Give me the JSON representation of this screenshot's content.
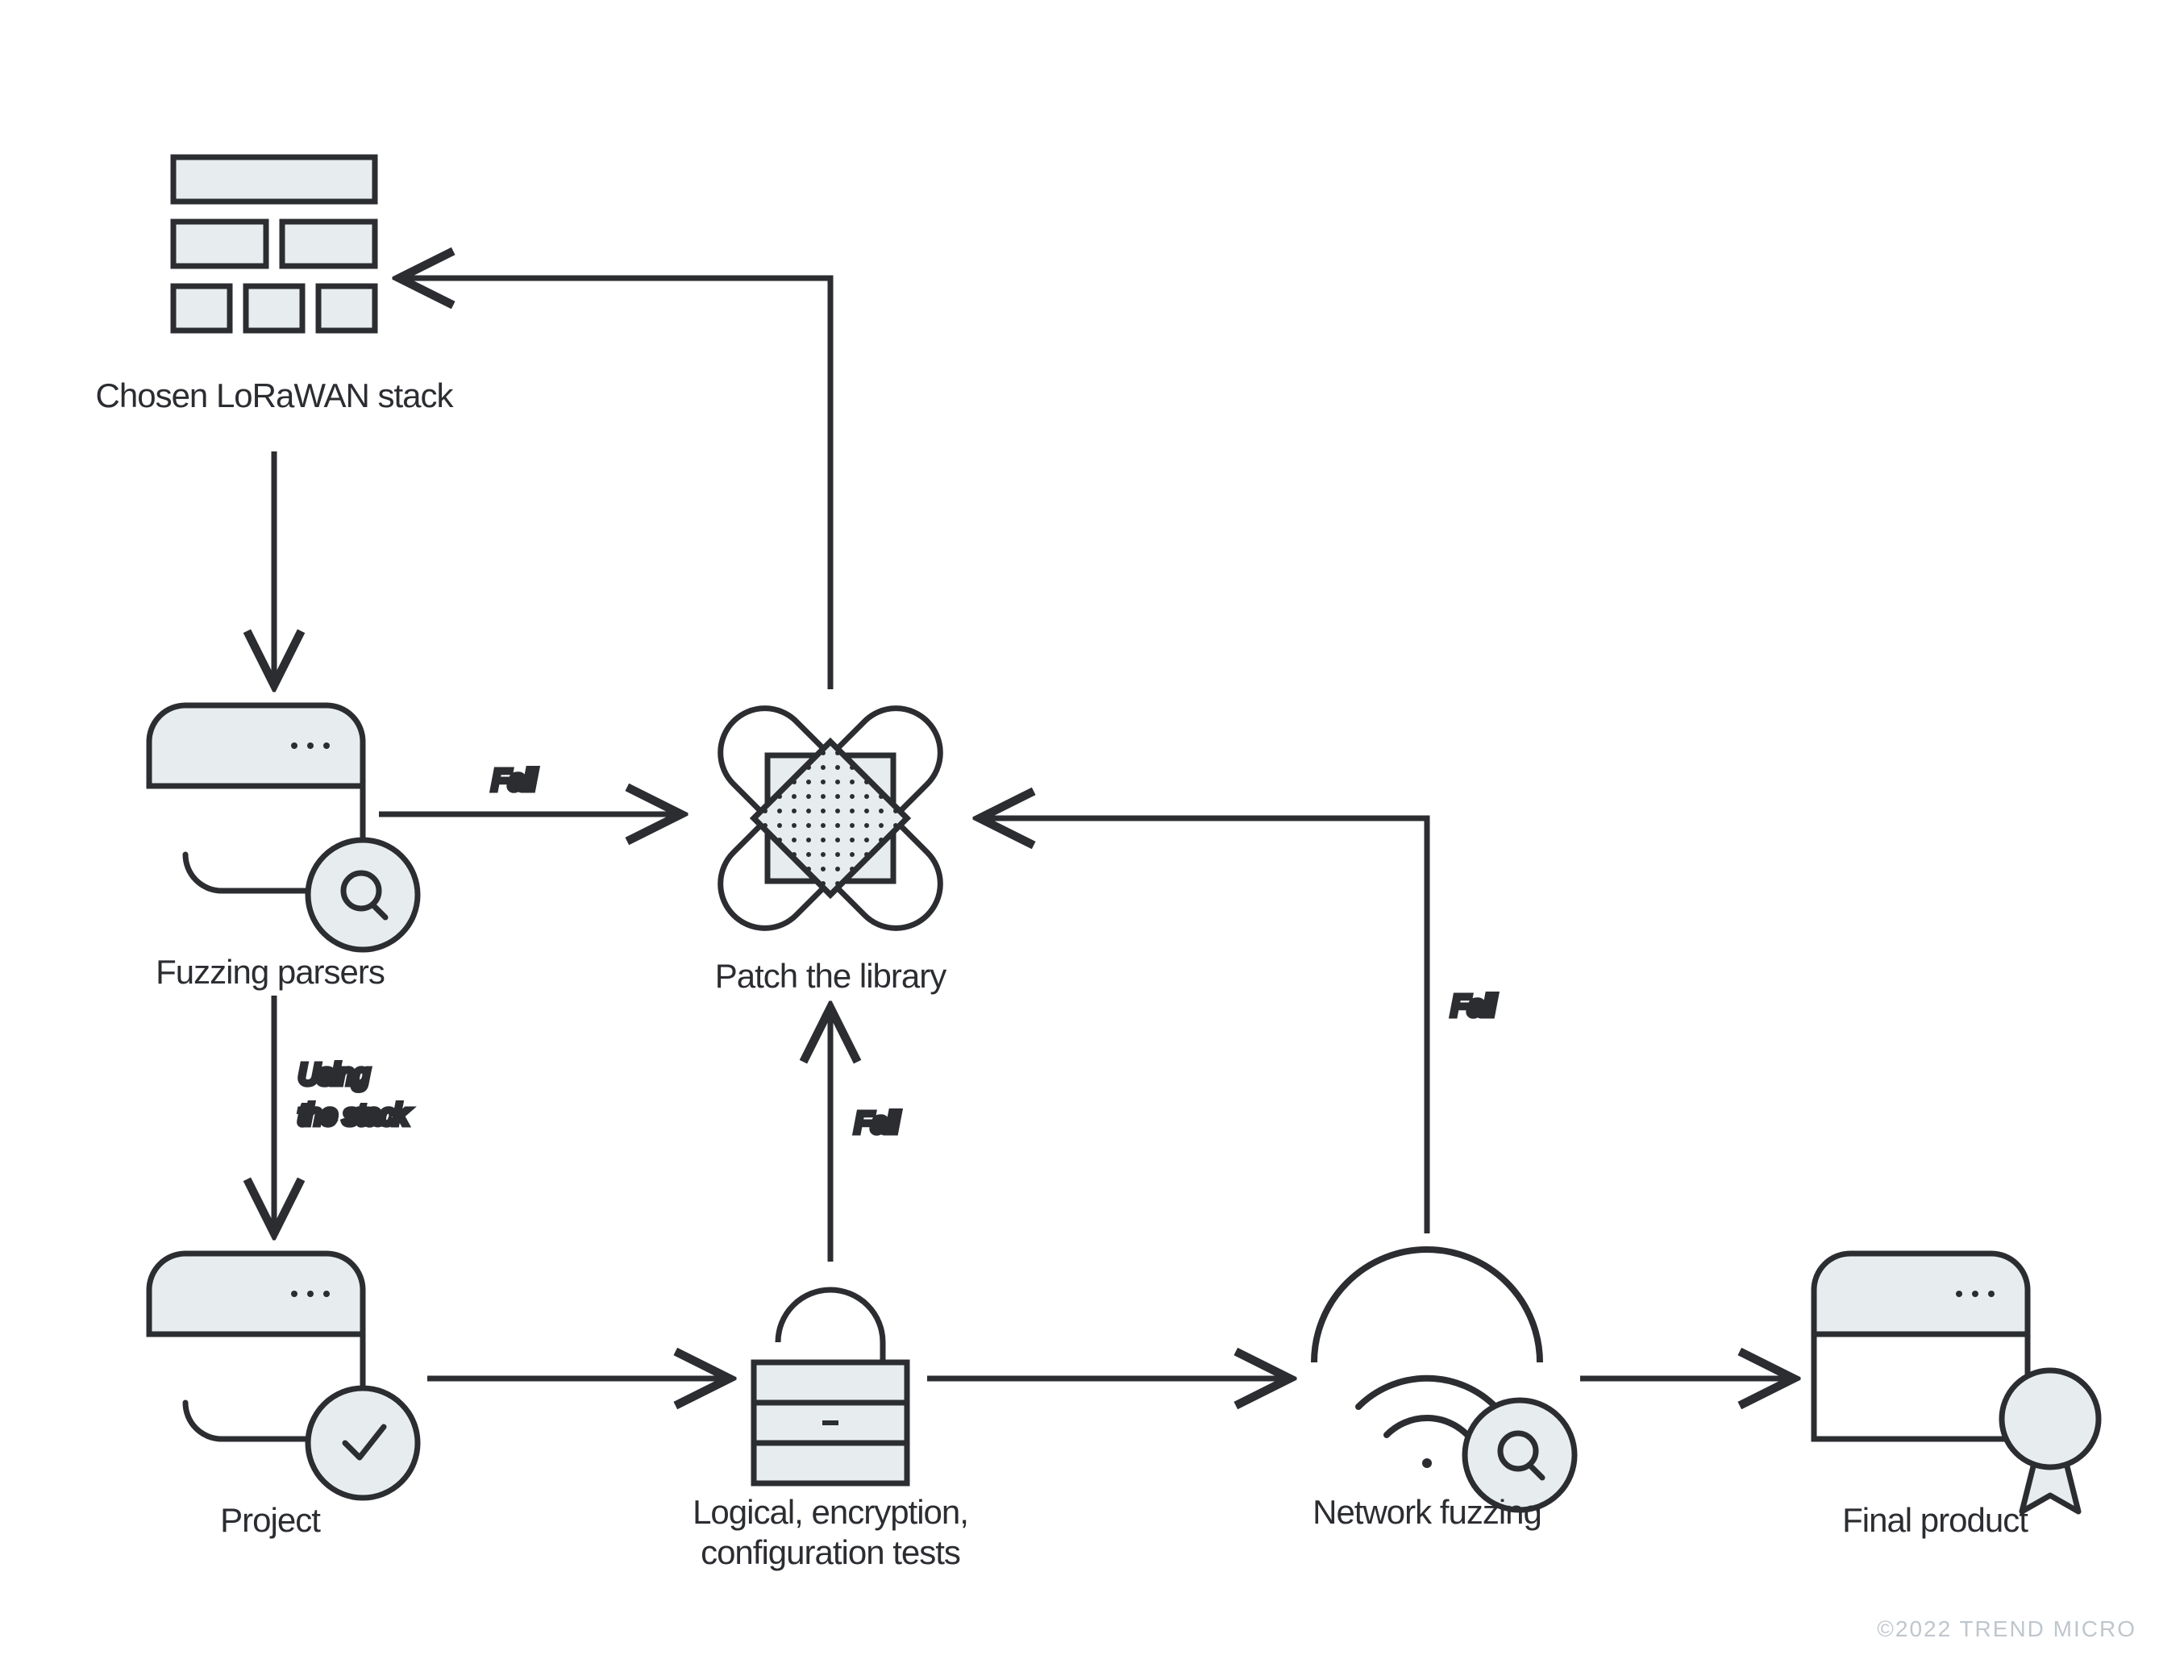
{
  "nodes": {
    "stack": {
      "label": "Chosen LoRaWAN stack"
    },
    "parsers": {
      "label": "Fuzzing parsers"
    },
    "patch": {
      "label": "Patch the library"
    },
    "project": {
      "label": "Project"
    },
    "tests": {
      "label1": "Logical, encryption,",
      "label2": "configuration tests"
    },
    "netfuzz": {
      "label": "Network fuzzing"
    },
    "final": {
      "label": "Final product"
    }
  },
  "edges": {
    "parsers_to_patch": "Fail",
    "tests_to_patch": "Fail",
    "netfuzz_to_patch": "Fail",
    "parsers_to_project_1": "Using",
    "parsers_to_project_2": "the stack"
  },
  "footer": "©2022 TREND MICRO"
}
